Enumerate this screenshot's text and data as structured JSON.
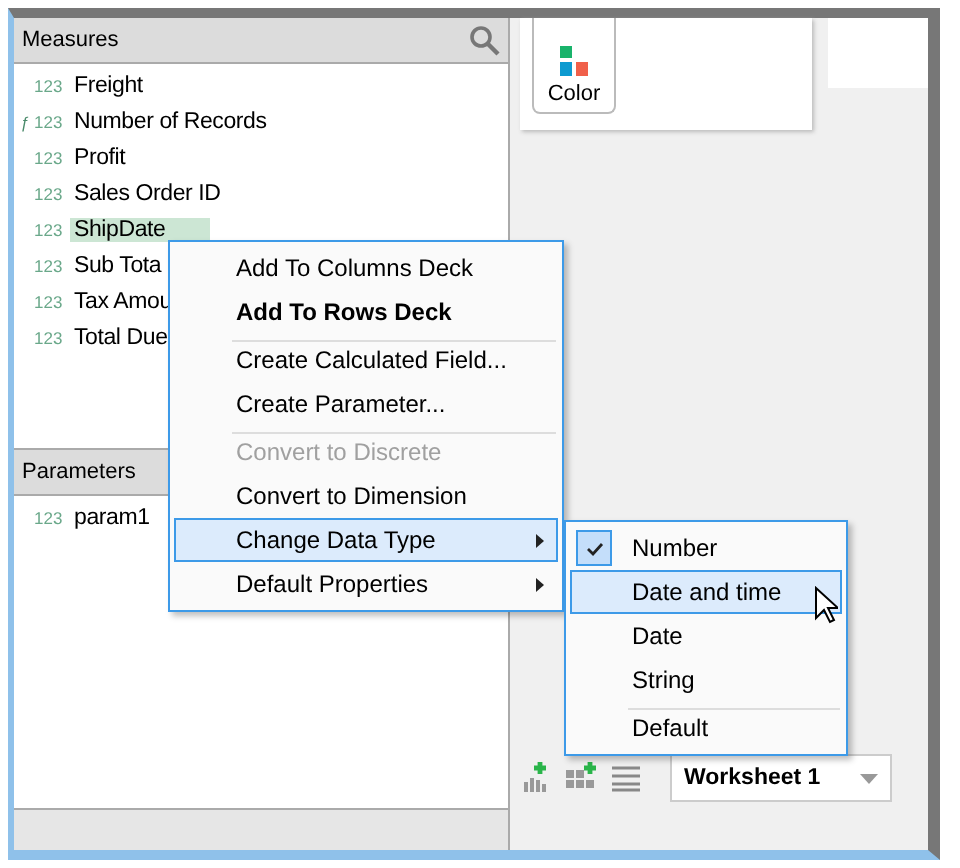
{
  "measures": {
    "title": "Measures",
    "items": [
      {
        "type_label": "123",
        "name": "Freight",
        "selected": false
      },
      {
        "type_label": "123",
        "prefix": "ƒ",
        "name": "Number of Records",
        "selected": false
      },
      {
        "type_label": "123",
        "name": "Profit",
        "selected": false
      },
      {
        "type_label": "123",
        "name": "Sales Order ID",
        "selected": false
      },
      {
        "type_label": "123",
        "name": "ShipDate",
        "selected": true
      },
      {
        "type_label": "123",
        "name": "Sub Tota",
        "selected": false
      },
      {
        "type_label": "123",
        "name": "Tax Amou",
        "selected": false
      },
      {
        "type_label": "123",
        "name": "Total Due",
        "selected": false
      }
    ]
  },
  "parameters": {
    "title": "Parameters",
    "items": [
      {
        "type_label": "123",
        "name": "param1",
        "selected": false
      }
    ]
  },
  "marks_card": {
    "button": "Color"
  },
  "context_menu": [
    {
      "label": "Add To Columns Deck",
      "bold": false,
      "disabled": false,
      "submenu": false,
      "selected": false,
      "divider_above": false
    },
    {
      "label": "Add To Rows Deck",
      "bold": true,
      "disabled": false,
      "submenu": false,
      "selected": false,
      "divider_above": false
    },
    {
      "label": "Create Calculated Field...",
      "bold": false,
      "disabled": false,
      "submenu": false,
      "selected": false,
      "divider_above": true
    },
    {
      "label": "Create Parameter...",
      "bold": false,
      "disabled": false,
      "submenu": false,
      "selected": false,
      "divider_above": false
    },
    {
      "label": "Convert to Discrete",
      "bold": false,
      "disabled": true,
      "submenu": false,
      "selected": false,
      "divider_above": true
    },
    {
      "label": "Convert to Dimension",
      "bold": false,
      "disabled": false,
      "submenu": false,
      "selected": false,
      "divider_above": false
    },
    {
      "label": "Change Data Type",
      "bold": false,
      "disabled": false,
      "submenu": true,
      "selected": true,
      "divider_above": false
    },
    {
      "label": "Default Properties",
      "bold": false,
      "disabled": false,
      "submenu": true,
      "selected": false,
      "divider_above": false
    }
  ],
  "submenu": [
    {
      "label": "Number",
      "checked": true,
      "selected": false,
      "divider_above": false
    },
    {
      "label": "Date and time",
      "checked": false,
      "selected": true,
      "divider_above": false
    },
    {
      "label": "Date",
      "checked": false,
      "selected": false,
      "divider_above": false
    },
    {
      "label": "String",
      "checked": false,
      "selected": false,
      "divider_above": false
    },
    {
      "label": "Default",
      "checked": false,
      "selected": false,
      "divider_above": true
    }
  ],
  "sheet_tab": {
    "label": "Worksheet 1"
  }
}
